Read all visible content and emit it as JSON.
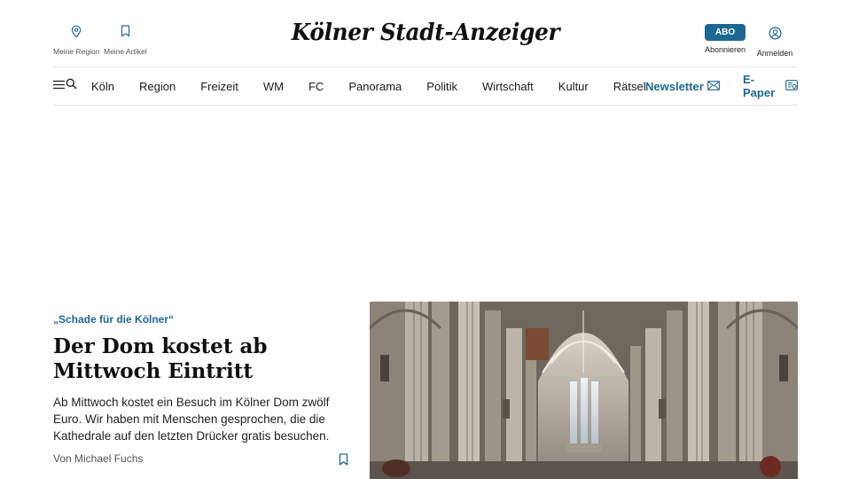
{
  "header": {
    "logo": "Kölner Stadt-Anzeiger",
    "my_region_label": "Meine Region",
    "my_articles_label": "Meine Artikel",
    "abo_label": "ABO",
    "subscribe_label": "Abonnieren",
    "login_label": "Anmelden"
  },
  "nav": {
    "items": [
      "Köln",
      "Region",
      "Freizeit",
      "WM",
      "FC",
      "Panorama",
      "Politik",
      "Wirtschaft",
      "Kultur",
      "Rätsel"
    ],
    "newsletter_label": "Newsletter",
    "epaper_label": "E-Paper"
  },
  "article": {
    "kicker": "„Schade für die Kölner“",
    "headline": "Der Dom kostet ab Mittwoch Eintritt",
    "teaser": "Ab Mittwoch kostet ein Besuch im Kölner Dom zwölf Euro. Wir haben mit Menschen gesprochen, die die Kathedrale auf den letzten Drücker gratis besuchen.",
    "author": "Von Michael Fuchs"
  },
  "colors": {
    "accent": "#1c6893",
    "text": "#1a1a1a",
    "divider": "#e4e4e4"
  },
  "icons": {
    "region": "location-pin-icon",
    "articles": "bookmark-icon",
    "login": "user-icon",
    "menu": "menu-icon",
    "search": "search-icon",
    "newsletter": "envelope-icon",
    "epaper": "epaper-icon"
  }
}
